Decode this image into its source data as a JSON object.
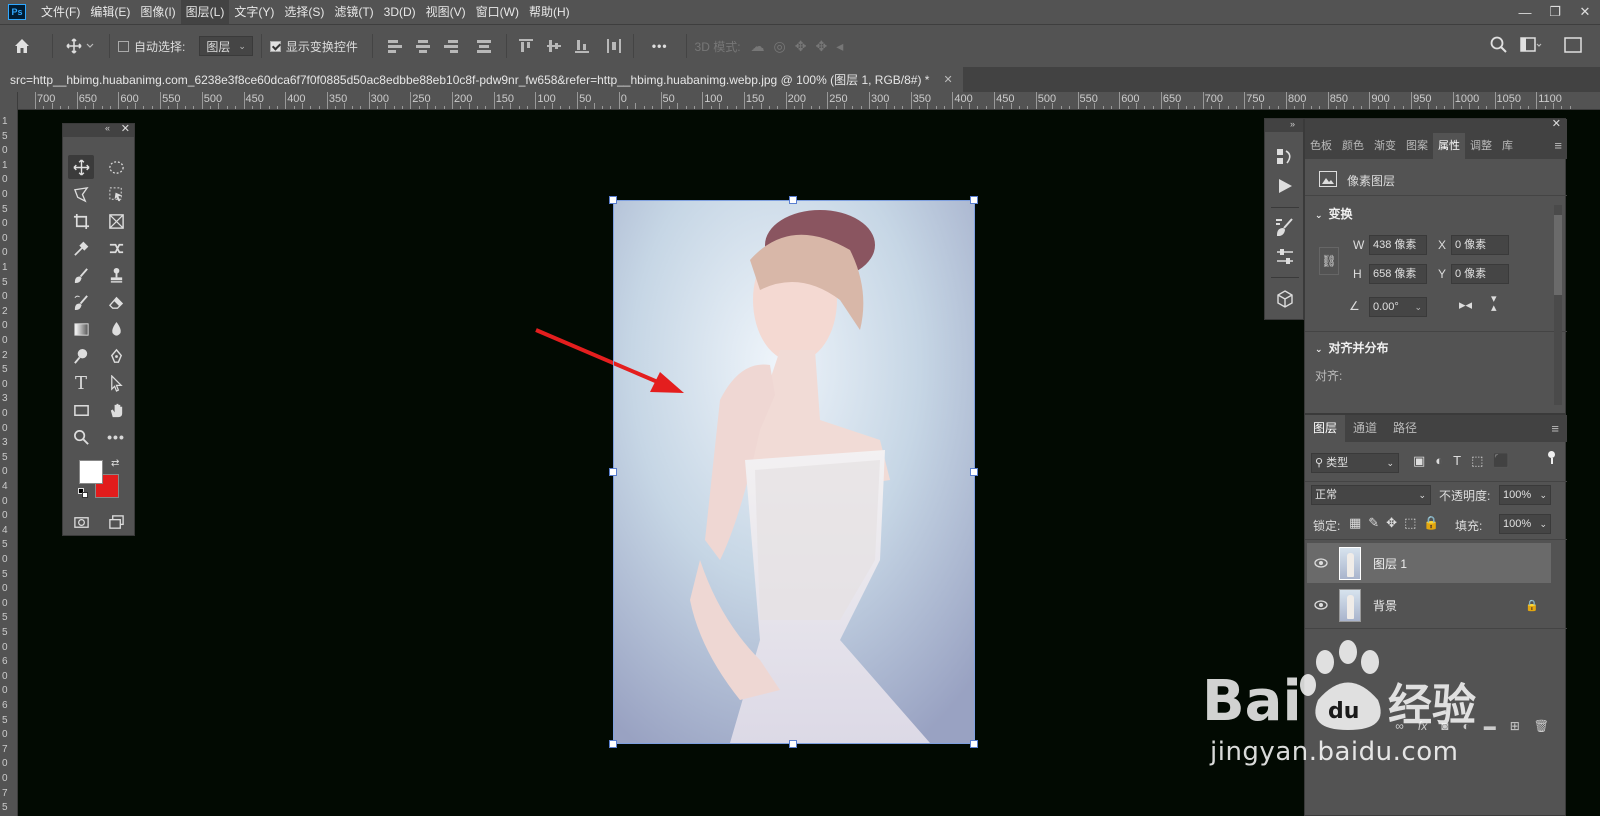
{
  "app": {
    "logo_text": "Ps"
  },
  "menu": [
    "文件(F)",
    "编辑(E)",
    "图像(I)",
    "图层(L)",
    "文字(Y)",
    "选择(S)",
    "滤镜(T)",
    "3D(D)",
    "视图(V)",
    "窗口(W)",
    "帮助(H)"
  ],
  "options": {
    "auto_select_label": "自动选择:",
    "auto_select_value": "图层",
    "show_transform_label": "显示变换控件",
    "more_label": "•••",
    "mode_3d_label": "3D 模式:"
  },
  "document": {
    "tab_title": "src=http__hbimg.huabanimg.com_6238e3f8ce60dca6f7f0f0885d50ac8edbbe88eb10c8f-pdw9nr_fw658&refer=http__hbimg.huabanimg.webp.jpg @ 100% (图层 1, RGB/8#) *"
  },
  "ruler": {
    "h_labels": [
      "700",
      "650",
      "600",
      "550",
      "500",
      "450",
      "400",
      "350",
      "300",
      "250",
      "200",
      "150",
      "100",
      "50",
      "0",
      "50",
      "100",
      "150",
      "200",
      "250",
      "300",
      "350",
      "400",
      "450",
      "500",
      "550",
      "600",
      "650",
      "700",
      "750",
      "800",
      "850",
      "900",
      "950",
      "1000",
      "1050",
      "1100"
    ],
    "v_labels": [
      "1",
      "5",
      "0",
      "1",
      "0",
      "0",
      "5",
      "0",
      "0",
      "0",
      "1",
      "5",
      "0",
      "2",
      "0",
      "0",
      "2",
      "5",
      "0",
      "3",
      "0",
      "0",
      "3",
      "5",
      "0",
      "4",
      "0",
      "0",
      "4",
      "5",
      "0",
      "5",
      "0",
      "0",
      "5",
      "5",
      "0",
      "6",
      "0",
      "0",
      "6",
      "5",
      "0",
      "7",
      "0",
      "0",
      "7",
      "5",
      "0"
    ]
  },
  "properties": {
    "tabs": [
      "色板",
      "颜色",
      "渐变",
      "图案",
      "属性",
      "调整",
      "库"
    ],
    "active_tab": "属性",
    "layer_type": "像素图层",
    "transform_header": "变换",
    "w_label": "W",
    "w_value": "438 像素",
    "h_label": "H",
    "h_value": "658 像素",
    "x_label": "X",
    "x_value": "0 像素",
    "y_label": "Y",
    "y_value": "0 像素",
    "angle_value": "0.00°",
    "align_header": "对齐并分布",
    "align_label": "对齐:"
  },
  "layers": {
    "tabs": [
      "图层",
      "通道",
      "路径"
    ],
    "filter_kind": "类型",
    "blend_mode": "正常",
    "opacity_label": "不透明度:",
    "opacity_value": "100%",
    "lock_label": "锁定:",
    "fill_label": "填充:",
    "fill_value": "100%",
    "items": [
      {
        "name": "图层 1",
        "selected": true,
        "locked": false
      },
      {
        "name": "背景",
        "selected": false,
        "locked": true
      }
    ]
  },
  "colors": {
    "foreground": "#ffffff",
    "background": "#e21c1c",
    "arrow": "#e41e1e",
    "accent": "#31a8ff"
  },
  "watermark": {
    "brand": "Baidu经验",
    "url": "jingyan.baidu.com"
  }
}
